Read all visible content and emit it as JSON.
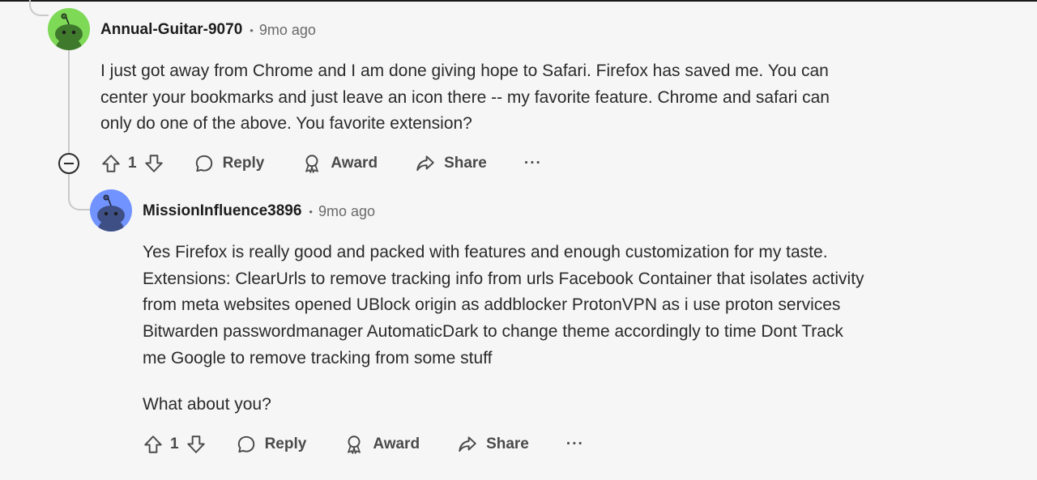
{
  "comments": [
    {
      "username": "Annual-Guitar-9070",
      "separator": "•",
      "time": "9mo ago",
      "avatar_color": "#7ed957",
      "lines": [
        "I just got away from Chrome and I am done giving hope to Safari. Firefox has saved me. You can",
        "center your bookmarks and just leave an icon there -- my favorite feature. Chrome and safari can",
        "only do one of the above. You favorite extension?"
      ],
      "votes": "1",
      "reply_label": "Reply",
      "award_label": "Award",
      "share_label": "Share",
      "more_label": "···"
    },
    {
      "username": "MissionInfluence3896",
      "separator": "•",
      "time": "9mo ago",
      "avatar_color": "#7193ff",
      "lines": [
        "Yes Firefox is really good and packed with features and enough customization for my taste.",
        "Extensions: ClearUrls to remove tracking info from urls Facebook Container that isolates activity",
        "from meta websites opened UBlock origin as addblocker ProtonVPN as i use proton services",
        "Bitwarden passwordmanager AutomaticDark to change theme accordingly to time Dont Track",
        "me Google to remove tracking from some stuff"
      ],
      "extra_line": "What about you?",
      "votes": "1",
      "reply_label": "Reply",
      "award_label": "Award",
      "share_label": "Share",
      "more_label": "···"
    }
  ],
  "colors": {
    "background": "#f6f6f6",
    "thread_line": "#c9c9c9",
    "meta_text": "#6a6a6a",
    "action_text": "#4a4a4a"
  }
}
